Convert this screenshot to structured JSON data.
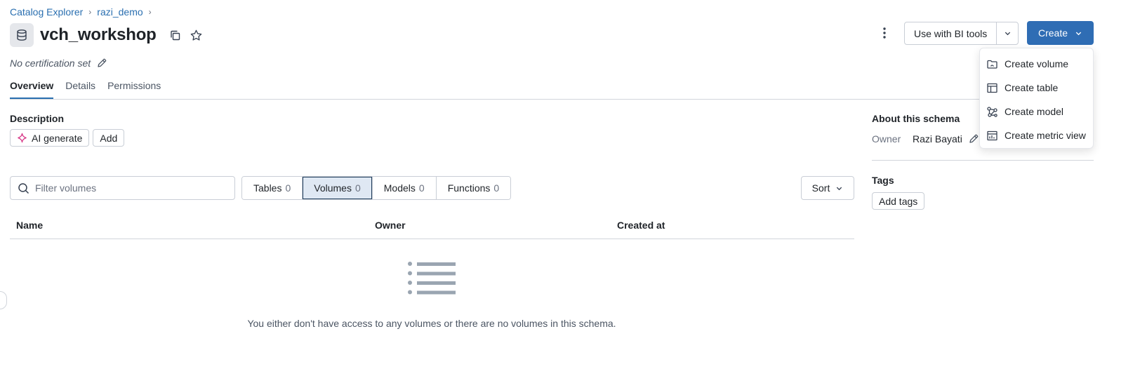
{
  "breadcrumb": {
    "items": [
      {
        "label": "Catalog Explorer"
      },
      {
        "label": "razi_demo"
      }
    ],
    "separator": "›"
  },
  "header": {
    "title": "vch_workshop",
    "certification": "No certification set",
    "icons": {
      "schema": "database-icon",
      "copy": "copy-icon",
      "favorite": "star-icon",
      "edit": "pencil-icon",
      "more": "kebab-menu-icon"
    }
  },
  "tabs": [
    {
      "label": "Overview",
      "active": true
    },
    {
      "label": "Details",
      "active": false
    },
    {
      "label": "Permissions",
      "active": false
    }
  ],
  "description": {
    "label": "Description",
    "ai_generate": "AI generate",
    "add": "Add"
  },
  "filter": {
    "placeholder": "Filter volumes",
    "value": ""
  },
  "segments": [
    {
      "label": "Tables",
      "count": "0",
      "active": false
    },
    {
      "label": "Volumes",
      "count": "0",
      "active": true
    },
    {
      "label": "Models",
      "count": "0",
      "active": false
    },
    {
      "label": "Functions",
      "count": "0",
      "active": false
    }
  ],
  "sort": {
    "label": "Sort"
  },
  "table": {
    "columns": [
      "Name",
      "Owner",
      "Created at"
    ],
    "empty_message": "You either don't have access to any volumes or there are no volumes in this schema."
  },
  "about": {
    "title": "About this schema",
    "owner_label": "Owner",
    "owner_value": "Razi Bayati",
    "tags_title": "Tags",
    "add_tags": "Add tags"
  },
  "toolbar": {
    "bi_tools": "Use with BI tools",
    "create": "Create"
  },
  "create_menu": {
    "items": [
      {
        "label": "Create volume",
        "icon": "volume-icon"
      },
      {
        "label": "Create table",
        "icon": "table-icon"
      },
      {
        "label": "Create model",
        "icon": "model-icon"
      },
      {
        "label": "Create metric view",
        "icon": "metric-view-icon"
      }
    ]
  },
  "colors": {
    "accent": "#2f6db4",
    "link": "#2a6fb0",
    "active_segment_bg": "#dfe8f3",
    "ai_icon": "#d63384"
  }
}
